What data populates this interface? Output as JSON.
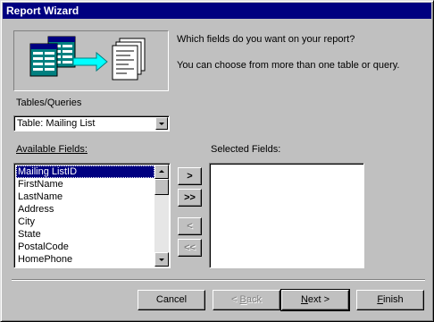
{
  "window": {
    "title": "Report Wizard",
    "colors": {
      "titlebar": "#000080",
      "face": "#c0c0c0",
      "selection": "#000080"
    }
  },
  "intro": {
    "question": "Which fields do you want on your report?",
    "hint": "You can choose from more than one table or query.",
    "illustration_icon": "tables-to-report-icon"
  },
  "tables": {
    "label": "Tables/Queries",
    "selected": "Table: Mailing List"
  },
  "available": {
    "label": "Available Fields:",
    "items": [
      "Mailing ListID",
      "FirstName",
      "LastName",
      "Address",
      "City",
      "State",
      "PostalCode",
      "HomePhone"
    ],
    "selected_index": 0
  },
  "selected_fields": {
    "label": "Selected Fields:",
    "items": []
  },
  "move_buttons": {
    "add_one": ">",
    "add_all": ">>",
    "remove_one": "<",
    "remove_all": "<<"
  },
  "footer": {
    "cancel": "Cancel",
    "back_accel": "B",
    "back_rest": "ack",
    "back_prefix": "< ",
    "next_accel": "N",
    "next_rest": "ext >",
    "finish_accel": "F",
    "finish_rest": "inish"
  }
}
